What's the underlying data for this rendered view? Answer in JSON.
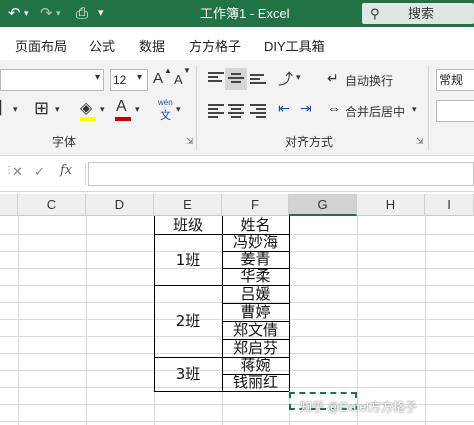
{
  "titlebar": {
    "title": "工作簿1  -  Excel",
    "search_label": "搜索",
    "icons": [
      "undo-icon",
      "redo-icon",
      "print-preview-icon",
      "customize-qat-icon",
      "search-icon"
    ]
  },
  "tabs": [
    "页面布局",
    "公式",
    "数据",
    "方方格子",
    "DIY工具箱"
  ],
  "ribbon": {
    "font_size": "12",
    "grow_font": "A",
    "shrink_font": "A",
    "font_color_letter": "A",
    "phonetic_top": "wén",
    "phonetic_bottom": "文",
    "wrap_text": "自动换行",
    "merge_center": "合并后居中",
    "number_format": "常规",
    "group_font": "字体",
    "group_alignment": "对齐方式",
    "accent_fill": "#ffff00",
    "accent_font": "#c00000"
  },
  "formula_bar": {
    "cancel": "✕",
    "enter": "✓",
    "fx": "fx",
    "value": ""
  },
  "columns": [
    "C",
    "D",
    "E",
    "F",
    "G",
    "H",
    "I"
  ],
  "table": {
    "header_class": "班级",
    "header_name": "姓名",
    "classes": [
      "1班",
      "2班",
      "3班"
    ],
    "names": [
      "冯妙海",
      "姜青",
      "华柔",
      "吕媛",
      "曹婷",
      "郑文倩",
      "郑启芬",
      "蒋婉",
      "钱丽红"
    ]
  },
  "watermark": "知乎 @Excel方方格子"
}
